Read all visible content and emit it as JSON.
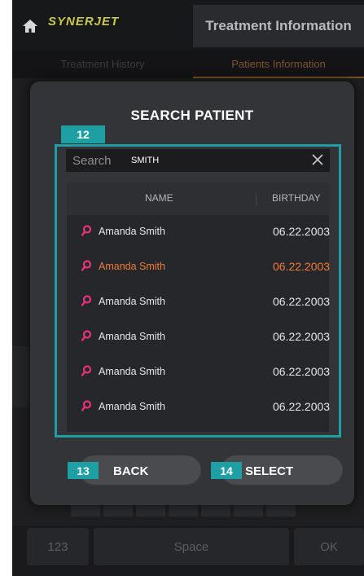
{
  "app": {
    "logo_text": "SYNERJET",
    "title": "Treatment Information",
    "tabs": [
      "Treatment History",
      "Patients Information"
    ],
    "active_tab": 1
  },
  "keyboard": {
    "key_123": "123",
    "key_space": "Space",
    "key_ok": "OK"
  },
  "modal": {
    "title": "SEARCH PATIENT",
    "annotations": {
      "search_area": "12",
      "back": "13",
      "select": "14"
    },
    "search": {
      "label": "Search",
      "value": "SMITH"
    },
    "columns": {
      "name": "NAME",
      "birthday": "BIRTHDAY"
    },
    "rows": [
      {
        "name": "Amanda Smith",
        "birthday": "06.22.2003"
      },
      {
        "name": "Amanda Smith",
        "birthday": "06.22.2003"
      },
      {
        "name": "Amanda Smith",
        "birthday": "06.22.2003"
      },
      {
        "name": "Amanda Smith",
        "birthday": "06.22.2003"
      },
      {
        "name": "Amanda Smith",
        "birthday": "06.22.2003"
      },
      {
        "name": "Amanda Smith",
        "birthday": "06.22.2003"
      }
    ],
    "selected_row": 1,
    "buttons": {
      "back": "BACK",
      "select": "SELECT"
    }
  },
  "colors": {
    "accent_teal": "#1e9fa4",
    "highlight_orange": "#f07a38",
    "pin_pink": "#e8337a",
    "logo_yellow": "#c9c94a"
  },
  "icons": {
    "home": "home-icon",
    "clear": "close-icon",
    "row": "location-pin-icon"
  }
}
